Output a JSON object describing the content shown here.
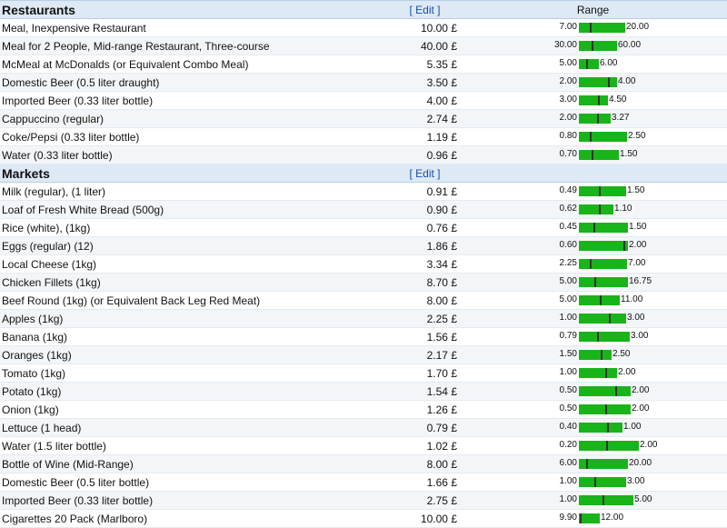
{
  "sections": [
    {
      "title": "Restaurants",
      "edit_label": "Edit",
      "range_label": "Range",
      "items": [
        {
          "name": "Meal, Inexpensive Restaurant",
          "price": "10.00 £",
          "min": "7.00",
          "max": "20.00",
          "min_v": 7.0,
          "max_v": 20.0,
          "val_v": 10.0
        },
        {
          "name": "Meal for 2 People, Mid-range Restaurant, Three-course",
          "price": "40.00 £",
          "min": "30.00",
          "max": "60.00",
          "min_v": 30.0,
          "max_v": 60.0,
          "val_v": 40.0
        },
        {
          "name": "McMeal at McDonalds (or Equivalent Combo Meal)",
          "price": "5.35 £",
          "min": "5.00",
          "max": "6.00",
          "min_v": 5.0,
          "max_v": 6.0,
          "val_v": 5.35
        },
        {
          "name": "Domestic Beer (0.5 liter draught)",
          "price": "3.50 £",
          "min": "2.00",
          "max": "4.00",
          "min_v": 2.0,
          "max_v": 4.0,
          "val_v": 3.5
        },
        {
          "name": "Imported Beer (0.33 liter bottle)",
          "price": "4.00 £",
          "min": "3.00",
          "max": "4.50",
          "min_v": 3.0,
          "max_v": 4.5,
          "val_v": 4.0
        },
        {
          "name": "Cappuccino (regular)",
          "price": "2.74 £",
          "min": "2.00",
          "max": "3.27",
          "min_v": 2.0,
          "max_v": 3.27,
          "val_v": 2.74
        },
        {
          "name": "Coke/Pepsi (0.33 liter bottle)",
          "price": "1.19 £",
          "min": "0.80",
          "max": "2.50",
          "min_v": 0.8,
          "max_v": 2.5,
          "val_v": 1.19
        },
        {
          "name": "Water (0.33 liter bottle)",
          "price": "0.96 £",
          "min": "0.70",
          "max": "1.50",
          "min_v": 0.7,
          "max_v": 1.5,
          "val_v": 0.96
        }
      ]
    },
    {
      "title": "Markets",
      "edit_label": "Edit",
      "range_label": "",
      "items": [
        {
          "name": "Milk (regular), (1 liter)",
          "price": "0.91 £",
          "min": "0.49",
          "max": "1.50",
          "min_v": 0.49,
          "max_v": 1.5,
          "val_v": 0.91
        },
        {
          "name": "Loaf of Fresh White Bread (500g)",
          "price": "0.90 £",
          "min": "0.62",
          "max": "1.10",
          "min_v": 0.62,
          "max_v": 1.1,
          "val_v": 0.9
        },
        {
          "name": "Rice (white), (1kg)",
          "price": "0.76 £",
          "min": "0.45",
          "max": "1.50",
          "min_v": 0.45,
          "max_v": 1.5,
          "val_v": 0.76
        },
        {
          "name": "Eggs (regular) (12)",
          "price": "1.86 £",
          "min": "0.60",
          "max": "2.00",
          "min_v": 0.6,
          "max_v": 2.0,
          "val_v": 1.86
        },
        {
          "name": "Local Cheese (1kg)",
          "price": "3.34 £",
          "min": "2.25",
          "max": "7.00",
          "min_v": 2.25,
          "max_v": 7.0,
          "val_v": 3.34
        },
        {
          "name": "Chicken Fillets (1kg)",
          "price": "8.70 £",
          "min": "5.00",
          "max": "16.75",
          "min_v": 5.0,
          "max_v": 16.75,
          "val_v": 8.7
        },
        {
          "name": "Beef Round (1kg) (or Equivalent Back Leg Red Meat)",
          "price": "8.00 £",
          "min": "5.00",
          "max": "11.00",
          "min_v": 5.0,
          "max_v": 11.0,
          "val_v": 8.0
        },
        {
          "name": "Apples (1kg)",
          "price": "2.25 £",
          "min": "1.00",
          "max": "3.00",
          "min_v": 1.0,
          "max_v": 3.0,
          "val_v": 2.25
        },
        {
          "name": "Banana (1kg)",
          "price": "1.56 £",
          "min": "0.79",
          "max": "3.00",
          "min_v": 0.79,
          "max_v": 3.0,
          "val_v": 1.56
        },
        {
          "name": "Oranges (1kg)",
          "price": "2.17 £",
          "min": "1.50",
          "max": "2.50",
          "min_v": 1.5,
          "max_v": 2.5,
          "val_v": 2.17
        },
        {
          "name": "Tomato (1kg)",
          "price": "1.70 £",
          "min": "1.00",
          "max": "2.00",
          "min_v": 1.0,
          "max_v": 2.0,
          "val_v": 1.7
        },
        {
          "name": "Potato (1kg)",
          "price": "1.54 £",
          "min": "0.50",
          "max": "2.00",
          "min_v": 0.5,
          "max_v": 2.0,
          "val_v": 1.54
        },
        {
          "name": "Onion (1kg)",
          "price": "1.26 £",
          "min": "0.50",
          "max": "2.00",
          "min_v": 0.5,
          "max_v": 2.0,
          "val_v": 1.26
        },
        {
          "name": "Lettuce (1 head)",
          "price": "0.79 £",
          "min": "0.40",
          "max": "1.00",
          "min_v": 0.4,
          "max_v": 1.0,
          "val_v": 0.79
        },
        {
          "name": "Water (1.5 liter bottle)",
          "price": "1.02 £",
          "min": "0.20",
          "max": "2.00",
          "min_v": 0.2,
          "max_v": 2.0,
          "val_v": 1.02
        },
        {
          "name": "Bottle of Wine (Mid-Range)",
          "price": "8.00 £",
          "min": "6.00",
          "max": "20.00",
          "min_v": 6.0,
          "max_v": 20.0,
          "val_v": 8.0
        },
        {
          "name": "Domestic Beer (0.5 liter bottle)",
          "price": "1.66 £",
          "min": "1.00",
          "max": "3.00",
          "min_v": 1.0,
          "max_v": 3.0,
          "val_v": 1.66
        },
        {
          "name": "Imported Beer (0.33 liter bottle)",
          "price": "2.75 £",
          "min": "1.00",
          "max": "5.00",
          "min_v": 1.0,
          "max_v": 5.0,
          "val_v": 2.75
        },
        {
          "name": "Cigarettes 20 Pack (Marlboro)",
          "price": "10.00 £",
          "min": "9.90",
          "max": "12.00",
          "min_v": 9.9,
          "max_v": 12.0,
          "val_v": 10.0
        }
      ]
    }
  ],
  "colors": {
    "bar": "#19b419",
    "tick": "#333333",
    "header_bg": "#dde9f5",
    "link": "#1a4fa3"
  }
}
